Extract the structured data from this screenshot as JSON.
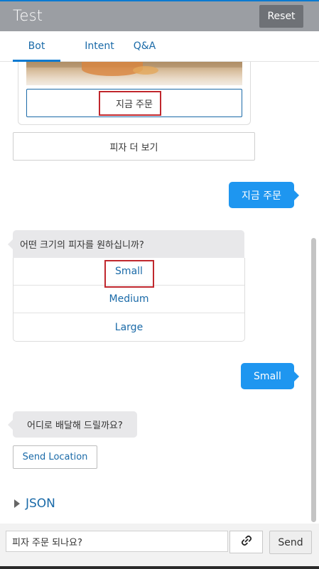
{
  "header": {
    "title": "Test",
    "reset_label": "Reset"
  },
  "tabs": [
    {
      "label": "Bot",
      "active": true
    },
    {
      "label": "Intent"
    },
    {
      "label": "Q&A"
    }
  ],
  "conversation": {
    "order_now_button": "지금 주문",
    "see_more_button": "피자 더 보기",
    "user_message_1": "지금 주문",
    "bot_size_question": "어떤 크기의 피자를 원하십니까?",
    "size_options": [
      "Small",
      "Medium",
      "Large"
    ],
    "user_message_2": "Small",
    "bot_delivery_question": "어디로 배달해 드릴까요?",
    "send_location_button": "Send Location",
    "json_toggle": "JSON"
  },
  "composer": {
    "input_value": "피자 주문 되나요?",
    "send_label": "Send"
  },
  "colors": {
    "accent": "#0b7ad1",
    "user_bubble": "#1e96f0",
    "highlight_box": "#c0272d",
    "header_bg": "#9b9ea3"
  },
  "icons": {
    "link": "link-icon",
    "expand": "caret-right-icon"
  }
}
